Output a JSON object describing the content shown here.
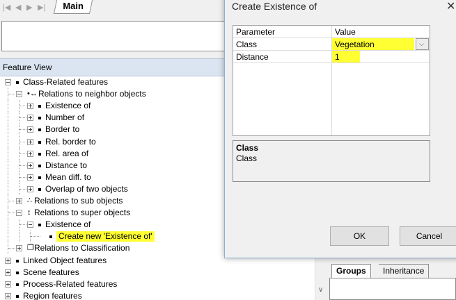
{
  "main_window": {
    "tab_label": "Main",
    "nav_glyphs": [
      "|◀",
      "◀",
      "▶",
      "▶|"
    ]
  },
  "feature_view": {
    "header": "Feature View",
    "tree": [
      {
        "label": "Class-Related features",
        "level": 0,
        "expander": "minus",
        "icon": "bullet"
      },
      {
        "label": "Relations to neighbor objects",
        "level": 1,
        "expander": "minus",
        "icon": "neighbor-icon"
      },
      {
        "label": "Existence of",
        "level": 2,
        "expander": "plus",
        "icon": "bullet"
      },
      {
        "label": "Number of",
        "level": 2,
        "expander": "plus",
        "icon": "bullet"
      },
      {
        "label": "Border to",
        "level": 2,
        "expander": "plus",
        "icon": "bullet"
      },
      {
        "label": "Rel. border to",
        "level": 2,
        "expander": "plus",
        "icon": "bullet"
      },
      {
        "label": "Rel. area of",
        "level": 2,
        "expander": "plus",
        "icon": "bullet"
      },
      {
        "label": "Distance to",
        "level": 2,
        "expander": "plus",
        "icon": "bullet"
      },
      {
        "label": "Mean diff. to",
        "level": 2,
        "expander": "plus",
        "icon": "bullet"
      },
      {
        "label": "Overlap of two objects",
        "level": 2,
        "expander": "plus",
        "icon": "bullet"
      },
      {
        "label": "Relations to sub objects",
        "level": 1,
        "expander": "plus",
        "icon": "sub-objects-icon"
      },
      {
        "label": "Relations to super objects",
        "level": 1,
        "expander": "minus",
        "icon": "super-objects-icon"
      },
      {
        "label": "Existence of",
        "level": 2,
        "expander": "minus",
        "icon": "bullet"
      },
      {
        "label": "Create new 'Existence of'",
        "level": 3,
        "expander": "none",
        "icon": "bullet",
        "highlighted": true
      },
      {
        "label": "Relations to Classification",
        "level": 1,
        "expander": "plus",
        "icon": "classification-icon"
      },
      {
        "label": "Linked Object features",
        "level": 0,
        "expander": "plus",
        "icon": "bullet"
      },
      {
        "label": "Scene features",
        "level": 0,
        "expander": "plus",
        "icon": "bullet"
      },
      {
        "label": "Process-Related features",
        "level": 0,
        "expander": "plus",
        "icon": "bullet"
      },
      {
        "label": "Region features",
        "level": 0,
        "expander": "plus",
        "icon": "bullet"
      }
    ]
  },
  "right_panel": {
    "tabs": [
      "Groups",
      "Inheritance"
    ]
  },
  "dialog": {
    "title": "Create Existence of",
    "close_glyph": "✕",
    "grid": {
      "headers": [
        "Parameter",
        "Value"
      ],
      "rows": [
        {
          "parameter": "Class",
          "value": "Vegetation"
        },
        {
          "parameter": "Distance",
          "value": "1"
        }
      ]
    },
    "description": {
      "title": "Class",
      "text": "Class"
    },
    "buttons": {
      "ok": "OK",
      "cancel": "Cancel"
    }
  },
  "colors": {
    "highlight": "#ffff33",
    "header_bg": "#dbe5f1"
  }
}
